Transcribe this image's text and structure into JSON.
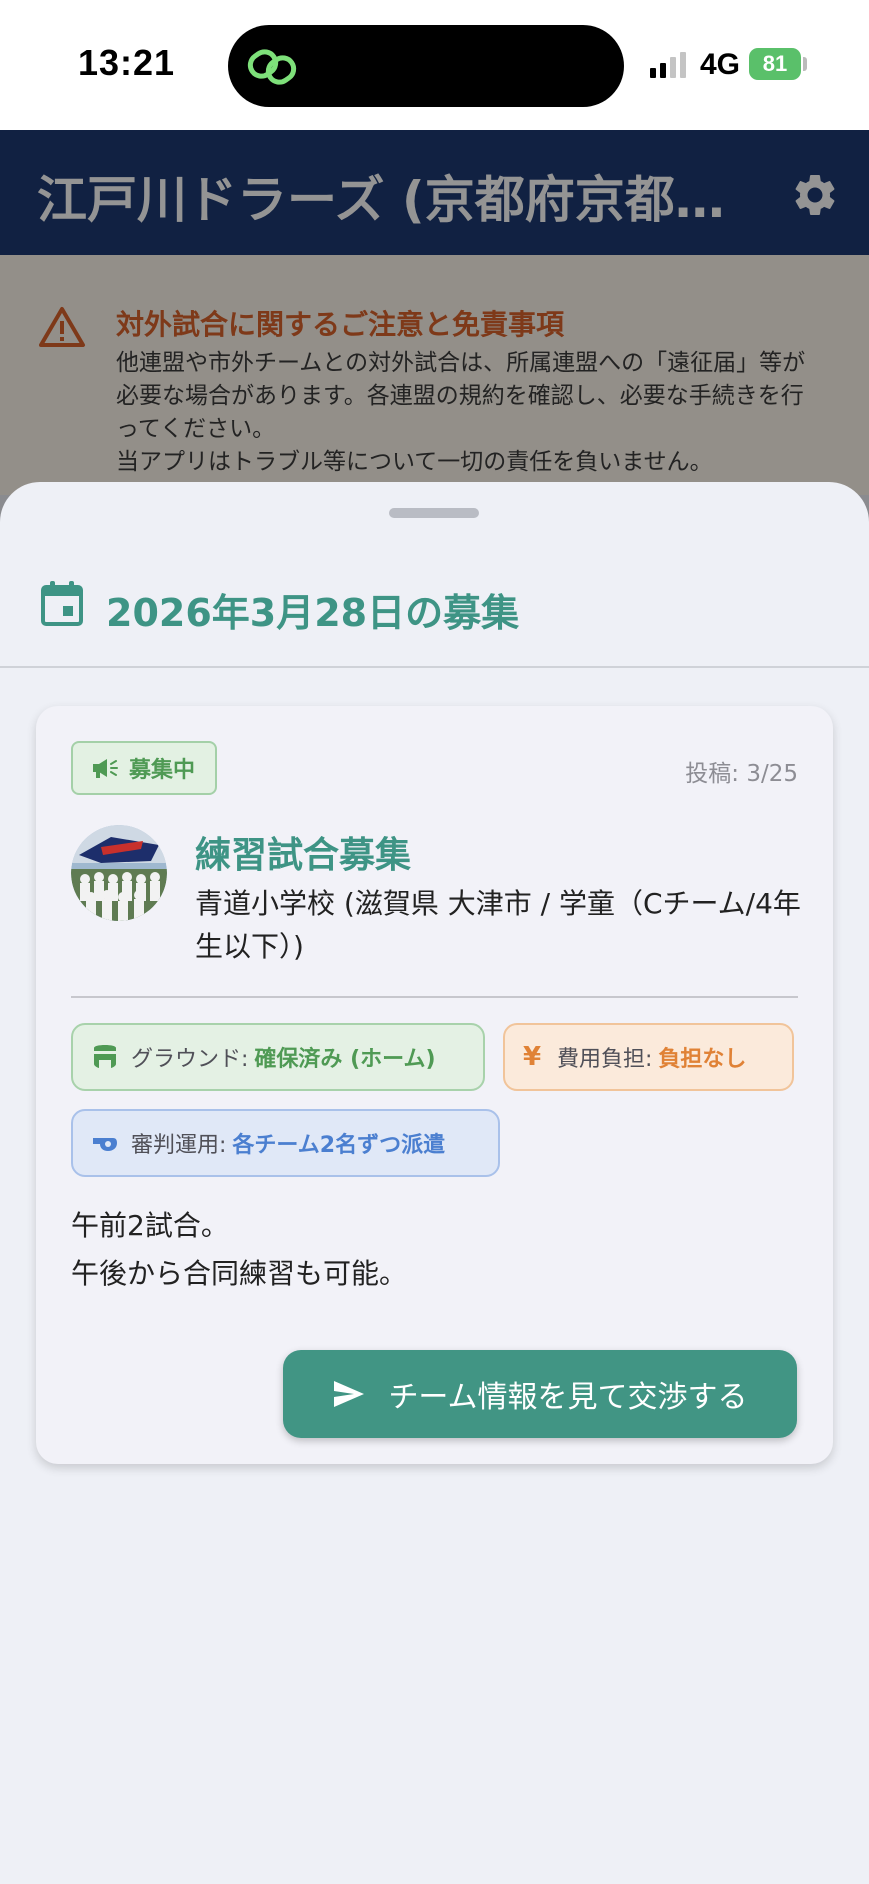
{
  "status_bar": {
    "time": "13:21",
    "network": "4G",
    "battery": "81"
  },
  "header": {
    "title": "江戸川ドラーズ (京都府京都…",
    "icons": {
      "settings": "gear-icon"
    }
  },
  "notice": {
    "icon": "warning-icon",
    "title": "対外試合に関するご注意と免責事項",
    "line1": "他連盟や市外チームとの対外試合は、所属連盟への「遠征届」等が必要な場合があります。各連盟の規約を確認し、必要な手続きを行ってください。",
    "line2": "当アプリはトラブル等について一切の責任を負いません。"
  },
  "sheet": {
    "icon": "calendar-icon",
    "title": "2026年3月28日の募集",
    "card": {
      "status": {
        "icon": "megaphone-icon",
        "label": "募集中"
      },
      "posted": "投稿: 3/25",
      "title": "練習試合募集",
      "location": "青道小学校 (滋賀県 大津市 / 学童（Cチーム/4年生以下）)",
      "chips": {
        "ground": {
          "icon": "stadium-icon",
          "key": "グラウンド:",
          "value": "確保済み (ホーム)"
        },
        "cost": {
          "icon": "yen-icon",
          "symbol": "¥",
          "key": "費用負担:",
          "value": "負担なし"
        },
        "referee": {
          "icon": "whistle-icon",
          "key": "審判運用:",
          "value": "各チーム2名ずつ派遣"
        }
      },
      "memo": {
        "line1": "午前2試合。",
        "line2": "午後から合同練習も可能。"
      },
      "cta": {
        "icon": "send-icon",
        "label": "チーム情報を見て交渉する"
      }
    }
  },
  "colors": {
    "accent": "#419584",
    "header_bg": "#1e3a72",
    "notice_title": "#d9622b",
    "ground": "#4f9a54",
    "cost": "#e08236",
    "referee": "#4b7fd0"
  }
}
